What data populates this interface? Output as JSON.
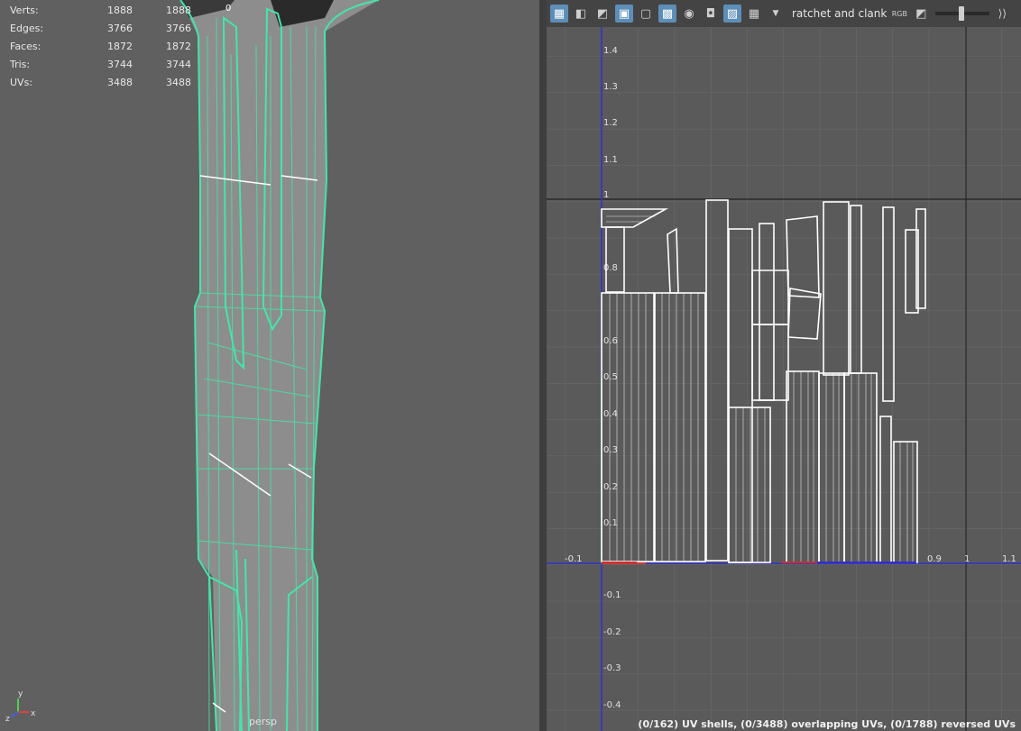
{
  "viewport": {
    "hud": [
      {
        "label": "Verts:",
        "v1": "1888",
        "v2": "1888"
      },
      {
        "label": "Edges:",
        "v1": "3766",
        "v2": "3766"
      },
      {
        "label": "Faces:",
        "v1": "1872",
        "v2": "1872"
      },
      {
        "label": "Tris:",
        "v1": "3744",
        "v2": "3744"
      },
      {
        "label": "UVs:",
        "v1": "3488",
        "v2": "3488"
      }
    ],
    "top_marker": "0",
    "camera_label": "persp",
    "axis_labels": {
      "x": "x",
      "y": "y",
      "z": "z"
    }
  },
  "uv_editor": {
    "toolbar": {
      "texture_name": "ratchet and clank",
      "rgb_label": "RGB",
      "icons": [
        "uv-shell-icon",
        "uv-split-icon",
        "uv-unfold-icon",
        "display-grid-icon",
        "uv-frame-icon",
        "checker-tiles-icon",
        "shaded-display-icon",
        "snapshot-icon",
        "image-display-icon",
        "checker-map-icon",
        "texture-dropdown-icon",
        "rgb-channel-icon",
        "exposure-icon",
        "gamma-icon"
      ]
    },
    "axis_ticks": {
      "u": [
        "-0.1",
        "0.9",
        "1",
        "1.1"
      ],
      "v": [
        "1.4",
        "1.3",
        "1.2",
        "1.1",
        "1",
        "0.8",
        "0.6",
        "0.5",
        "0.4",
        "0.3",
        "0.2",
        "0.1",
        "-0.1",
        "-0.2",
        "-0.3",
        "-0.4"
      ]
    },
    "status": "(0/162) UV shells, (0/3488) overlapping UVs, (0/1788) reversed UVs"
  }
}
